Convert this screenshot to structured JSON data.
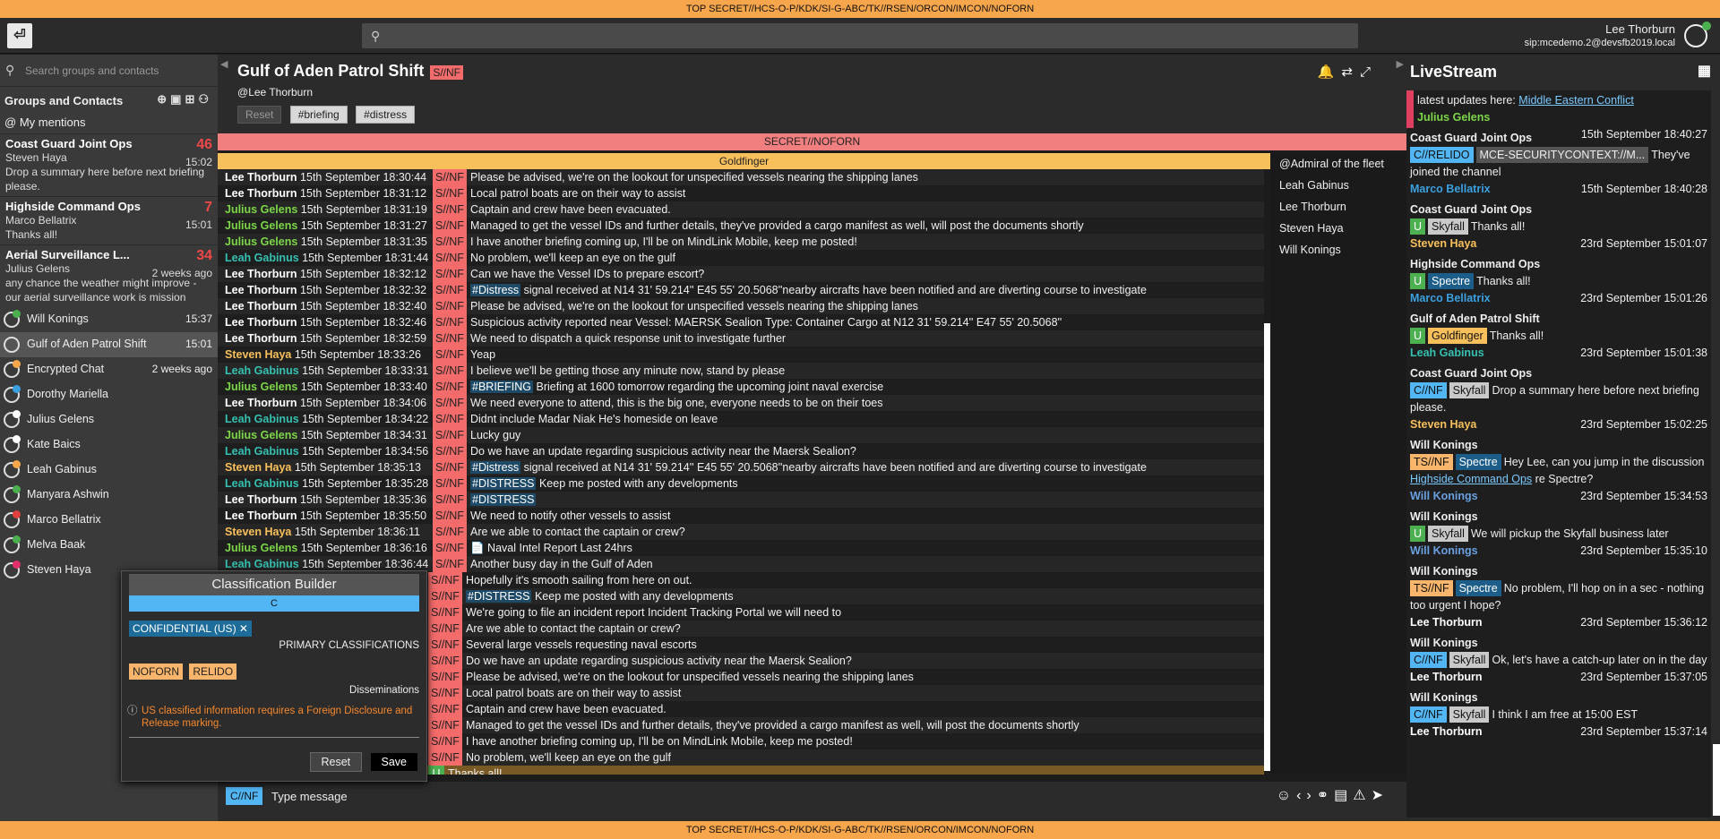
{
  "banner": "TOP SECRET//HCS-O-P/KDK/SI-G-ABC/TK//RSEN/ORCON/IMCON/NOFORN",
  "user": {
    "name": "Lee Thorburn",
    "sip": "sip:mcedemo.2@devsfb2019.local"
  },
  "left": {
    "search_placeholder": "Search groups and contacts",
    "header": "Groups and Contacts",
    "mentions": "My mentions",
    "groups": [
      {
        "title": "Coast Guard Joint Ops",
        "count": "46",
        "author": "Steven Haya",
        "time": "15:02",
        "preview": "Drop a summary here before next briefing please."
      },
      {
        "title": "Highside Command Ops",
        "count": "7",
        "author": "Marco Bellatrix",
        "time": "15:01",
        "preview": "Thanks all!"
      },
      {
        "title": "Aerial Surveillance L...",
        "count": "34",
        "author": "Julius Gelens",
        "time": "2 weeks ago",
        "preview": "any chance the weather might improve - our aerial surveillance work is mission"
      }
    ],
    "contacts": [
      {
        "name": "Will Konings",
        "right": "15:37",
        "dot": "#4caf50"
      },
      {
        "name": "Gulf of Aden Patrol Shift",
        "right": "15:01",
        "dot": ""
      },
      {
        "name": "Encrypted Chat",
        "right": "2 weeks ago",
        "dot": "#f7a64c"
      },
      {
        "name": "Dorothy Mariella",
        "right": "",
        "dot": "#3aa0e0"
      },
      {
        "name": "Julius Gelens",
        "right": "",
        "dot": "#fff"
      },
      {
        "name": "Kate Baics",
        "right": "",
        "dot": "#fff"
      },
      {
        "name": "Leah Gabinus",
        "right": "",
        "dot": "#f7a64c"
      },
      {
        "name": "Manyara Ashwin",
        "right": "",
        "dot": "#4caf50"
      },
      {
        "name": "Marco Bellatrix",
        "right": "",
        "dot": "#e04040"
      },
      {
        "name": "Melva Baak",
        "right": "",
        "dot": "#4caf50"
      },
      {
        "name": "Steven Haya",
        "right": "",
        "dot": "#e0306a"
      }
    ]
  },
  "chat": {
    "title": "Gulf of Aden Patrol Shift",
    "title_class": "S//NF",
    "subtitle": "Lee Thorburn",
    "tags": [
      "Reset",
      "#briefing",
      "#distress"
    ],
    "sec_banner": "SECRET//NOFORN",
    "gf_banner": "Goldfinger",
    "members": [
      "@Admiral of the fleet",
      "Leah Gabinus",
      "Lee Thorburn",
      "Steven Haya",
      "Will Konings"
    ],
    "composer_class": "C//NF",
    "composer_placeholder": "Type message",
    "messages": [
      {
        "a": "Lee Thorburn",
        "d": "15th September 18:30:44",
        "c": "S//NF",
        "t": "Please be advised, we're on the lookout for unspecified vessels nearing the shipping lanes",
        "col": "#fff"
      },
      {
        "a": "Lee Thorburn",
        "d": "15th September 18:31:12",
        "c": "S//NF",
        "t": "Local patrol boats are on their way to assist",
        "col": "#fff"
      },
      {
        "a": "Julius Gelens",
        "d": "15th September 18:31:19",
        "c": "S//NF",
        "t": "Captain and crew have been evacuated.",
        "col": "#7cd648"
      },
      {
        "a": "Julius Gelens",
        "d": "15th September 18:31:27",
        "c": "S//NF",
        "t": "Managed to get the vessel IDs and further details, they've provided a cargo manifest as well, will post the documents shortly",
        "col": "#7cd648"
      },
      {
        "a": "Julius Gelens",
        "d": "15th September 18:31:35",
        "c": "S//NF",
        "t": "I have another briefing coming up, I'll be on MindLink Mobile, keep me posted!",
        "col": "#7cd648"
      },
      {
        "a": "Leah Gabinus",
        "d": "15th September 18:31:44",
        "c": "S//NF",
        "t": "No problem, we'll keep an eye on the gulf",
        "col": "#35c0b0"
      },
      {
        "a": "Lee Thorburn",
        "d": "15th September 18:32:12",
        "c": "S//NF",
        "t": "Can we have the Vessel IDs to prepare escort?",
        "col": "#fff"
      },
      {
        "a": "Lee Thorburn",
        "d": "15th September 18:32:32",
        "c": "S//NF",
        "h": "#Distress",
        "t": "signal received at N14 31' 59.214''  E45 55' 20.5068''nearby aircrafts have been notified and are diverting course to investigate",
        "col": "#fff"
      },
      {
        "a": "Lee Thorburn",
        "d": "15th September 18:32:40",
        "c": "S//NF",
        "t": "Please be advised, we're on the lookout for unspecified vessels nearing the shipping lanes",
        "col": "#fff"
      },
      {
        "a": "Lee Thorburn",
        "d": "15th September 18:32:46",
        "c": "S//NF",
        "t": "Suspicious activity reported near Vessel: MAERSK Sealion Type: Container Cargo at N12 31' 59.214''  E47 55' 20.5068''",
        "col": "#fff"
      },
      {
        "a": "Lee Thorburn",
        "d": "15th September 18:32:59",
        "c": "S//NF",
        "t": "We need to dispatch a quick response unit to investigate further",
        "col": "#fff"
      },
      {
        "a": "Steven Haya",
        "d": "15th September 18:33:26",
        "c": "S//NF",
        "t": "Yeap",
        "col": "#f8c05b"
      },
      {
        "a": "Leah Gabinus",
        "d": "15th September 18:33:31",
        "c": "S//NF",
        "t": "I believe we'll be getting those any minute now, stand by please",
        "col": "#35c0b0"
      },
      {
        "a": "Julius Gelens",
        "d": "15th September 18:33:40",
        "c": "S//NF",
        "h": "#BRIEFING",
        "t": "Briefing at 1600 tomorrow regarding the upcoming joint naval exercise",
        "col": "#7cd648"
      },
      {
        "a": "Lee Thorburn",
        "d": "15th September 18:34:06",
        "c": "S//NF",
        "t": "We need everyone to attend, this is the big one, everyone needs to be on their toes",
        "col": "#fff"
      },
      {
        "a": "Leah Gabinus",
        "d": "15th September 18:34:22",
        "c": "S//NF",
        "t": "Didnt include Madar Niak He's homeside on leave",
        "col": "#35c0b0"
      },
      {
        "a": "Julius Gelens",
        "d": "15th September 18:34:31",
        "c": "S//NF",
        "t": "Lucky guy",
        "col": "#7cd648"
      },
      {
        "a": "Leah Gabinus",
        "d": "15th September 18:34:56",
        "c": "S//NF",
        "t": "Do we have an update regarding suspicious activity near the Maersk Sealion?",
        "col": "#35c0b0"
      },
      {
        "a": "Steven Haya",
        "d": "15th September 18:35:13",
        "c": "S//NF",
        "h": "#Distress",
        "t": "signal received at N14 31' 59.214''  E45 55' 20.5068''nearby aircrafts have been notified and are diverting course to investigate",
        "col": "#f8c05b"
      },
      {
        "a": "Leah Gabinus",
        "d": "15th September 18:35:28",
        "c": "S//NF",
        "h": "#DISTRESS",
        "t": "Keep me posted with any developments",
        "col": "#35c0b0"
      },
      {
        "a": "Lee Thorburn",
        "d": "15th September 18:35:36",
        "c": "S//NF",
        "h": "#DISTRESS",
        "t": "",
        "col": "#fff"
      },
      {
        "a": "Lee Thorburn",
        "d": "15th September 18:35:50",
        "c": "S//NF",
        "t": "We need to notify other vessels to assist",
        "col": "#fff"
      },
      {
        "a": "Steven Haya",
        "d": "15th September 18:36:11",
        "c": "S//NF",
        "t": "Are we able to contact the captain or crew?",
        "col": "#f8c05b"
      },
      {
        "a": "Julius Gelens",
        "d": "15th September 18:36:16",
        "c": "S//NF",
        "t": "📄 Naval Intel Report Last 24hrs",
        "col": "#7cd648"
      },
      {
        "a": "Leah Gabinus",
        "d": "15th September 18:36:44",
        "c": "S//NF",
        "t": "Another busy day in the Gulf of Aden",
        "col": "#35c0b0"
      },
      {
        "a": "",
        "d": "",
        "c": "S//NF",
        "t": "Hopefully it's smooth sailing from here on out.",
        "col": "#fff"
      },
      {
        "a": "",
        "d": "",
        "c": "S//NF",
        "h": "#DISTRESS",
        "t": "Keep me posted with any developments",
        "col": "#fff"
      },
      {
        "a": "",
        "d": "",
        "c": "S//NF",
        "t": "We're going to file an incident report Incident Tracking Portal we will need to",
        "col": "#fff"
      },
      {
        "a": "",
        "d": "",
        "c": "S//NF",
        "t": "Are we able to contact the captain or crew?",
        "col": "#fff"
      },
      {
        "a": "",
        "d": "",
        "c": "S//NF",
        "t": "Several large vessels requesting naval escorts",
        "col": "#fff"
      },
      {
        "a": "",
        "d": "",
        "c": "S//NF",
        "t": "Do we have an update regarding suspicious activity near the Maersk Sealion?",
        "col": "#fff"
      },
      {
        "a": "",
        "d": "",
        "c": "S//NF",
        "t": "Please be advised, we're on the lookout for unspecified vessels nearing the shipping lanes",
        "col": "#fff"
      },
      {
        "a": "",
        "d": "",
        "c": "S//NF",
        "t": "Local patrol boats are on their way to assist",
        "col": "#fff"
      },
      {
        "a": "",
        "d": "",
        "c": "S//NF",
        "t": "Captain and crew have been evacuated.",
        "col": "#fff"
      },
      {
        "a": "",
        "d": "",
        "c": "S//NF",
        "t": "Managed to get the vessel IDs and further details, they've provided a cargo manifest as well, will post the documents shortly",
        "col": "#fff"
      },
      {
        "a": "",
        "d": "",
        "c": "S//NF",
        "t": "I have another briefing coming up, I'll be on MindLink Mobile, keep me posted!",
        "col": "#fff"
      },
      {
        "a": "",
        "d": "",
        "c": "S//NF",
        "t": "No problem, we'll keep an eye on the gulf",
        "col": "#fff"
      },
      {
        "a": "",
        "d": "",
        "c": "U",
        "t": "Thanks all!",
        "col": "#fff",
        "hl": true
      }
    ]
  },
  "builder": {
    "title": "Classification Builder",
    "level": "C",
    "chip": "CONFIDENTIAL (US) ✕",
    "primary": "PRIMARY CLASSIFICATIONS",
    "dissem": [
      "NOFORN",
      "RELIDO"
    ],
    "dissem_label": "Disseminations",
    "warning": "US classified information requires a Foreign Disclosure and Release marking.",
    "reset": "Reset",
    "save": "Save"
  },
  "live": {
    "title": "LiveStream",
    "items": [
      {
        "ch": "",
        "pre": "latest updates here:",
        "link": "Middle Eastern Conflict",
        "au": "Julius Gelens",
        "auc": "#7cd648",
        "tm": "15th September 18:40:27",
        "badges": []
      },
      {
        "ch": "Coast Guard Joint Ops",
        "badges": [
          [
            "cr",
            "C//RELIDO"
          ],
          [
            "ctx",
            "MCE-SECURITYCONTEXT://M..."
          ]
        ],
        "pre": "They've joined the channel",
        "au": "Marco Bellatrix",
        "auc": "#3aa0e0",
        "tm": "15th September 18:40:28"
      },
      {
        "ch": "Coast Guard Joint Ops",
        "badges": [
          [
            "u",
            "U"
          ],
          [
            "sky",
            "Skyfall"
          ]
        ],
        "pre": "Thanks all!",
        "au": "Steven Haya",
        "auc": "#f8c05b",
        "tm": "23rd September 15:01:07"
      },
      {
        "ch": "Highside Command Ops",
        "badges": [
          [
            "u",
            "U"
          ],
          [
            "spe",
            "Spectre"
          ]
        ],
        "pre": "Thanks all!",
        "au": "Marco Bellatrix",
        "auc": "#3aa0e0",
        "tm": "23rd September 15:01:26"
      },
      {
        "ch": "Gulf of Aden Patrol Shift",
        "badges": [
          [
            "u",
            "U"
          ],
          [
            "gf",
            "Goldfinger"
          ]
        ],
        "pre": "Thanks all!",
        "au": "Leah Gabinus",
        "auc": "#35c0b0",
        "tm": "23rd September 15:01:38"
      },
      {
        "ch": "Coast Guard Joint Ops",
        "badges": [
          [
            "cr",
            "C//NF"
          ],
          [
            "sky",
            "Skyfall"
          ]
        ],
        "pre": "Drop a summary here before next briefing please.",
        "au": "Steven Haya",
        "auc": "#f8c05b",
        "tm": "23rd September 15:02:25"
      },
      {
        "ch": "Will Konings",
        "badges": [
          [
            "ts",
            "TS//NF"
          ],
          [
            "spe",
            "Spectre"
          ]
        ],
        "pre": "Hey Lee, can you jump in the discussion",
        "link": "Highside Command Ops",
        "post": "re Spectre?",
        "au": "Will Konings",
        "auc": "#6aa0e0",
        "tm": "23rd September 15:34:53"
      },
      {
        "ch": "Will Konings",
        "badges": [
          [
            "u",
            "U"
          ],
          [
            "sky",
            "Skyfall"
          ]
        ],
        "pre": "We will pickup the Skyfall business later",
        "au": "Will Konings",
        "auc": "#6aa0e0",
        "tm": "23rd September 15:35:10"
      },
      {
        "ch": "Will Konings",
        "badges": [
          [
            "ts",
            "TS//NF"
          ],
          [
            "spe",
            "Spectre"
          ]
        ],
        "pre": "No problem, I'll hop on in a sec - nothing too urgent I hope?",
        "au": "Lee Thorburn",
        "auc": "#fff",
        "tm": "23rd September 15:36:12"
      },
      {
        "ch": "Will Konings",
        "badges": [
          [
            "cr",
            "C//NF"
          ],
          [
            "sky",
            "Skyfall"
          ]
        ],
        "pre": "Ok, let's have a catch-up later on in the day",
        "au": "Lee Thorburn",
        "auc": "#fff",
        "tm": "23rd September 15:37:05"
      },
      {
        "ch": "Will Konings",
        "badges": [
          [
            "cr",
            "C//NF"
          ],
          [
            "sky",
            "Skyfall"
          ]
        ],
        "pre": "I think I am free at 15:00 EST",
        "au": "Lee Thorburn",
        "auc": "#fff",
        "tm": "23rd September 15:37:14"
      }
    ]
  }
}
